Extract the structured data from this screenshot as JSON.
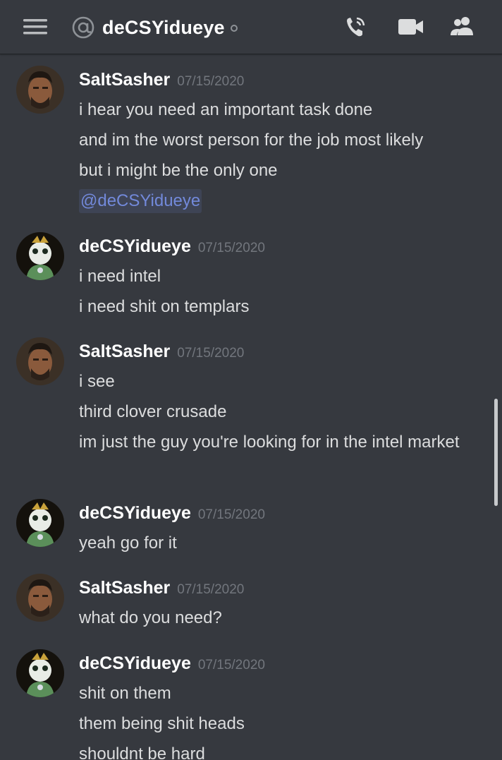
{
  "header": {
    "channel_name": "deCSYidueye",
    "status": "offline"
  },
  "icons": {
    "menu": "hamburger-menu-icon",
    "at": "at-sign-icon",
    "call": "phone-call-icon",
    "video": "video-camera-icon",
    "members": "members-icon"
  },
  "colors": {
    "background": "#36393f",
    "username": "#ffffff",
    "timestamp": "#72767d",
    "text": "#dcddde",
    "mention": "#7289da"
  },
  "messages": [
    {
      "author": "SaltSasher",
      "timestamp": "07/15/2020",
      "lines": [
        "i hear you need an important task done",
        "and im the worst person for the job most likely",
        "but i might be the only one"
      ],
      "mention": "@deCSYidueye"
    },
    {
      "author": "deCSYidueye",
      "timestamp": "07/15/2020",
      "lines": [
        "i need intel",
        "i need shit on templars"
      ]
    },
    {
      "author": "SaltSasher",
      "timestamp": "07/15/2020",
      "lines": [
        "i see",
        "third clover crusade",
        "im just the guy you're looking for in the intel market"
      ]
    },
    {
      "author": "deCSYidueye",
      "timestamp": "07/15/2020",
      "lines": [
        "yeah go for it"
      ]
    },
    {
      "author": "SaltSasher",
      "timestamp": "07/15/2020",
      "lines": [
        "what do you need?"
      ]
    },
    {
      "author": "deCSYidueye",
      "timestamp": "07/15/2020",
      "lines": [
        "shit on them",
        "them being shit heads",
        "shouldnt be hard"
      ]
    }
  ]
}
